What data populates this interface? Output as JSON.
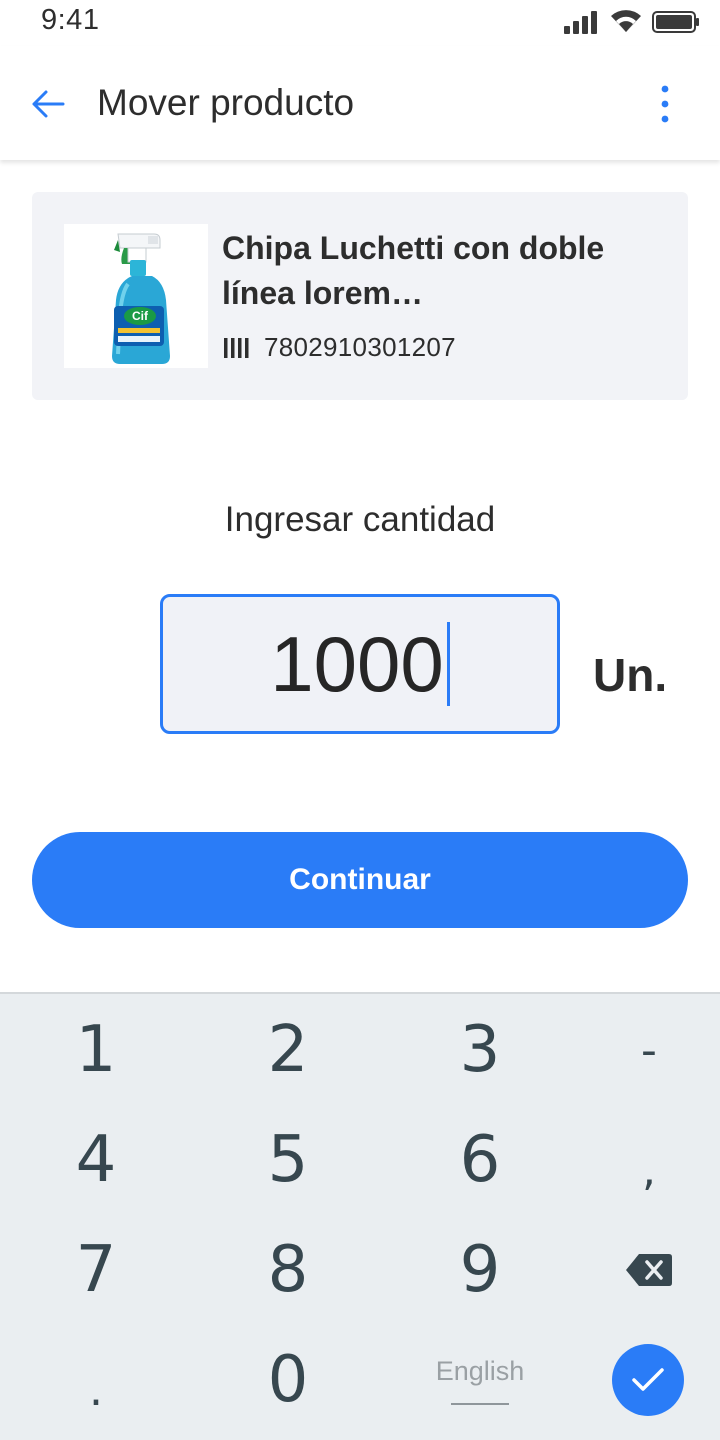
{
  "status_bar": {
    "time": "9:41",
    "icons": [
      "signal-icon",
      "wifi-icon",
      "battery-icon"
    ]
  },
  "app_bar": {
    "title": "Mover producto",
    "back_icon": "arrow-left-icon",
    "menu_icon": "more-vert-icon"
  },
  "product": {
    "name": "Chipa Luchetti con doble línea lorem…",
    "barcode": "7802910301207",
    "image": "product-image-cif-spray"
  },
  "quantity": {
    "label": "Ingresar cantidad",
    "value": "1000",
    "unit": "Un."
  },
  "actions": {
    "continue_label": "Continuar"
  },
  "keyboard": {
    "keys": [
      "1",
      "2",
      "3",
      "-",
      "4",
      "5",
      "6",
      ",",
      "7",
      "8",
      "9",
      "backspace",
      ".",
      "0",
      "English",
      "done"
    ],
    "language": "English"
  },
  "colors": {
    "accent": "#2a7cf7",
    "card_bg": "#f2f3f7",
    "keyboard_bg": "#eaeef1",
    "text": "#2d2d2d"
  }
}
